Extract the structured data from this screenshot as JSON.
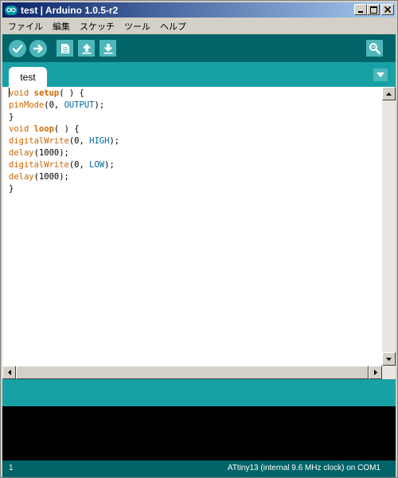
{
  "window": {
    "title": "test | Arduino 1.0.5-r2"
  },
  "menu": [
    {
      "label": "ファイル"
    },
    {
      "label": "編集"
    },
    {
      "label": "スケッチ"
    },
    {
      "label": "ツール"
    },
    {
      "label": "ヘルプ"
    }
  ],
  "toolbar": {
    "icons": [
      "verify-icon",
      "upload-icon",
      "new-icon",
      "open-icon",
      "save-icon",
      "serial-monitor-icon"
    ]
  },
  "tabs": {
    "active_label": "test"
  },
  "editor": {
    "lines": [
      [
        {
          "t": "void",
          "c": "kw",
          "caret": true
        },
        {
          "t": " "
        },
        {
          "t": "setup",
          "c": "kwb"
        },
        {
          "t": "( ) {"
        }
      ],
      [
        {
          "t": "pinMode",
          "c": "kw"
        },
        {
          "t": "(0, "
        },
        {
          "t": "OUTPUT",
          "c": "const"
        },
        {
          "t": ");"
        }
      ],
      [
        {
          "t": "}"
        }
      ],
      [
        {
          "t": "void",
          "c": "kw"
        },
        {
          "t": " "
        },
        {
          "t": "loop",
          "c": "kwb"
        },
        {
          "t": "( ) {"
        }
      ],
      [
        {
          "t": "digitalWrite",
          "c": "kw"
        },
        {
          "t": "(0, "
        },
        {
          "t": "HIGH",
          "c": "const"
        },
        {
          "t": ");"
        }
      ],
      [
        {
          "t": "delay",
          "c": "kw"
        },
        {
          "t": "(1000);"
        }
      ],
      [
        {
          "t": "digitalWrite",
          "c": "kw"
        },
        {
          "t": "(0, "
        },
        {
          "t": "LOW",
          "c": "const"
        },
        {
          "t": ");"
        }
      ],
      [
        {
          "t": "delay",
          "c": "kw"
        },
        {
          "t": "(1000);"
        }
      ],
      [
        {
          "t": "}"
        }
      ]
    ]
  },
  "status": {
    "line_number": "1",
    "board": "ATtiny13 (internal 9.6 MHz clock) on COM1"
  },
  "colors": {
    "toolbar": "#006468",
    "tabbar": "#17a1a5",
    "button": "#4db7bb",
    "keyword": "#cc6600",
    "constant": "#006699"
  }
}
